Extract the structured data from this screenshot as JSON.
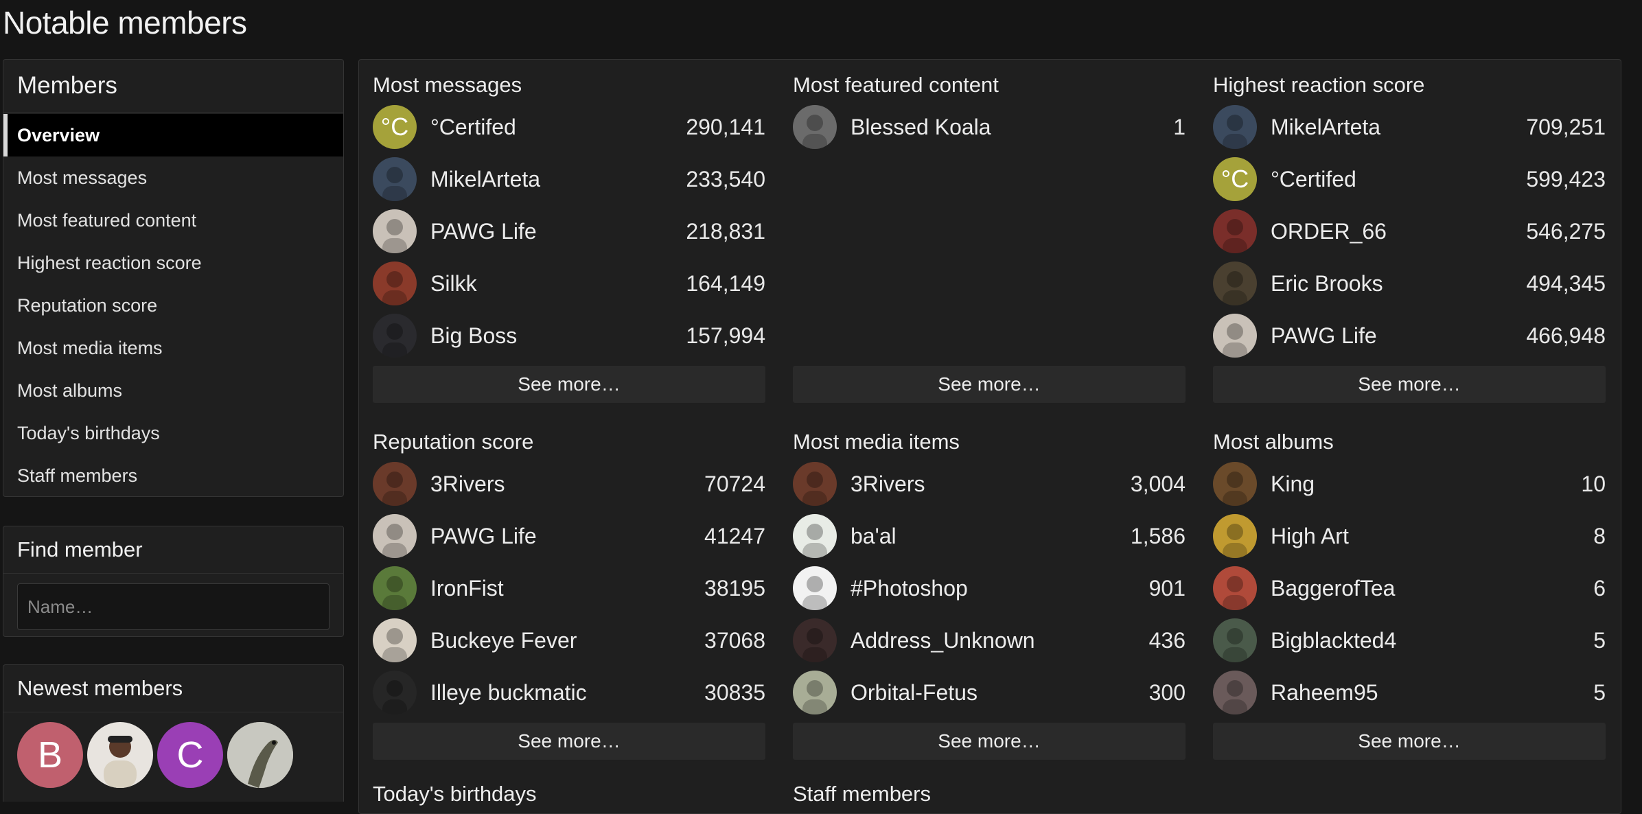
{
  "page": {
    "title": "Notable members"
  },
  "sidebar": {
    "members_header": "Members",
    "nav": [
      {
        "label": "Overview",
        "selected": true
      },
      {
        "label": "Most messages"
      },
      {
        "label": "Most featured content"
      },
      {
        "label": "Highest reaction score"
      },
      {
        "label": "Reputation score"
      },
      {
        "label": "Most media items"
      },
      {
        "label": "Most albums"
      },
      {
        "label": "Today's birthdays"
      },
      {
        "label": "Staff members"
      }
    ],
    "find_header": "Find member",
    "find_placeholder": "Name…",
    "newest_header": "Newest members",
    "newest": [
      {
        "letter": "B",
        "color": "#c0606e"
      },
      {
        "letter": "",
        "icon": "user-photo-icon"
      },
      {
        "letter": "C",
        "color": "#9a3fb5"
      },
      {
        "letter": "",
        "icon": "lizard-photo-icon"
      }
    ]
  },
  "sections": [
    {
      "title": "Most messages",
      "see_more": "See more…",
      "rows": [
        {
          "name": "°Certifed",
          "value": "290,141",
          "avatar": "°C",
          "color": "#a5a23a"
        },
        {
          "name": "MikelArteta",
          "value": "233,540",
          "color": "#3b4a5e"
        },
        {
          "name": "PAWG Life",
          "value": "218,831",
          "color": "#c9c1b8"
        },
        {
          "name": "Silkk",
          "value": "164,149",
          "color": "#8a3a2a"
        },
        {
          "name": "Big Boss",
          "value": "157,994",
          "color": "#2a2a2e"
        }
      ]
    },
    {
      "title": "Most featured content",
      "see_more": "See more…",
      "rows": [
        {
          "name": "Blessed Koala",
          "value": "1",
          "color": "#6b6b6b"
        }
      ]
    },
    {
      "title": "Highest reaction score",
      "see_more": "See more…",
      "rows": [
        {
          "name": "MikelArteta",
          "value": "709,251",
          "color": "#3b4a5e"
        },
        {
          "name": "°Certifed",
          "value": "599,423",
          "avatar": "°C",
          "color": "#a5a23a"
        },
        {
          "name": "ORDER_66",
          "value": "546,275",
          "color": "#7a2e2a"
        },
        {
          "name": "Eric Brooks",
          "value": "494,345",
          "color": "#4a4030"
        },
        {
          "name": "PAWG Life",
          "value": "466,948",
          "color": "#c9c1b8"
        }
      ]
    },
    {
      "title": "Reputation score",
      "see_more": "See more…",
      "rows": [
        {
          "name": "3Rivers",
          "value": "70724",
          "color": "#6a3a2a"
        },
        {
          "name": "PAWG Life",
          "value": "41247",
          "color": "#c9c1b8"
        },
        {
          "name": "IronFist",
          "value": "38195",
          "color": "#5a7a3a"
        },
        {
          "name": "Buckeye Fever",
          "value": "37068",
          "color": "#d8d0c4"
        },
        {
          "name": "Illeye buckmatic",
          "value": "30835",
          "color": "#262626"
        }
      ]
    },
    {
      "title": "Most media items",
      "see_more": "See more…",
      "rows": [
        {
          "name": "3Rivers",
          "value": "3,004",
          "color": "#6a3a2a"
        },
        {
          "name": "ba'al",
          "value": "1,586",
          "color": "#e8ece6"
        },
        {
          "name": "#Photoshop",
          "value": "901",
          "color": "#f2f2f2"
        },
        {
          "name": "Address_Unknown",
          "value": "436",
          "color": "#3a2a2a"
        },
        {
          "name": "Orbital-Fetus",
          "value": "300",
          "color": "#a8ad96"
        }
      ]
    },
    {
      "title": "Most albums",
      "see_more": "See more…",
      "rows": [
        {
          "name": "King",
          "value": "10",
          "color": "#6a4a2a"
        },
        {
          "name": "High Art",
          "value": "8",
          "color": "#c09a30"
        },
        {
          "name": "BaggerofTea",
          "value": "6",
          "color": "#b04a3a"
        },
        {
          "name": "Bigblackted4",
          "value": "5",
          "color": "#4a5a4a"
        },
        {
          "name": "Raheem95",
          "value": "5",
          "color": "#6a5a5a"
        }
      ]
    }
  ],
  "cut_titles": [
    "Today's birthdays",
    "Staff members"
  ]
}
